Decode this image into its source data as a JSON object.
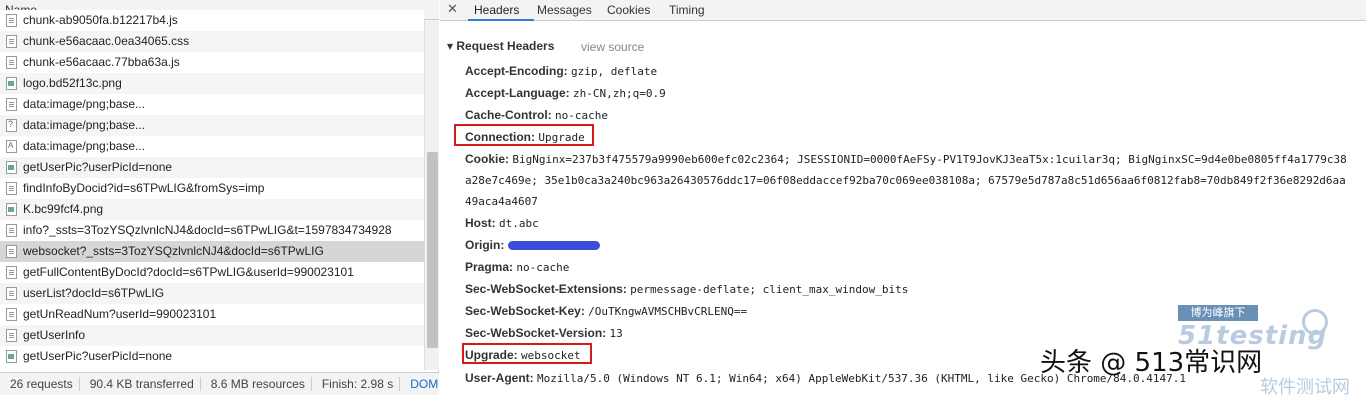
{
  "network": {
    "column_name": "Name",
    "rows": [
      {
        "name": "chunk-ab9050fa.b12217b4.js",
        "icon": "doc"
      },
      {
        "name": "chunk-e56acaac.0ea34065.css",
        "icon": "doc"
      },
      {
        "name": "chunk-e56acaac.77bba63a.js",
        "icon": "doc"
      },
      {
        "name": "logo.bd52f13c.png",
        "icon": "img"
      },
      {
        "name": "data:image/png;base...",
        "icon": "doc"
      },
      {
        "name": "data:image/png;base...",
        "icon": "q"
      },
      {
        "name": "data:image/png;base...",
        "icon": "a"
      },
      {
        "name": "getUserPic?userPicId=none",
        "icon": "img"
      },
      {
        "name": "findInfoByDocid?id=s6TPwLIG&fromSys=imp",
        "icon": "doc"
      },
      {
        "name": "K.bc99fcf4.png",
        "icon": "img"
      },
      {
        "name": "info?_ssts=3TozYSQzlvnlcNJ4&docId=s6TPwLIG&t=1597834734928",
        "icon": "doc"
      },
      {
        "name": "websocket?_ssts=3TozYSQzlvnlcNJ4&docId=s6TPwLIG",
        "icon": "doc"
      },
      {
        "name": "getFullContentByDocId?docId=s6TPwLIG&userId=990023101",
        "icon": "doc"
      },
      {
        "name": "userList?docId=s6TPwLIG",
        "icon": "doc"
      },
      {
        "name": "getUnReadNum?userId=990023101",
        "icon": "doc"
      },
      {
        "name": "getUserInfo",
        "icon": "doc"
      },
      {
        "name": "getUserPic?userPicId=none",
        "icon": "img"
      }
    ],
    "selected_index": 11,
    "status": {
      "requests": "26 requests",
      "transferred": "90.4 KB transferred",
      "resources": "8.6 MB resources",
      "finish": "Finish: 2.98 s",
      "domcontent": "DOMC"
    }
  },
  "details": {
    "close_glyph": "✕",
    "tabs": [
      "Headers",
      "Messages",
      "Cookies",
      "Timing"
    ],
    "active_tab": "Headers",
    "section_title": "▾ Request Headers",
    "view_source": "view source",
    "headers": [
      {
        "name": "Accept-Encoding:",
        "value": "gzip, deflate"
      },
      {
        "name": "Accept-Language:",
        "value": "zh-CN,zh;q=0.9"
      },
      {
        "name": "Cache-Control:",
        "value": "no-cache"
      },
      {
        "name": "Connection:",
        "value": "Upgrade",
        "highlighted": true
      },
      {
        "name": "Cookie:",
        "value": "BigNginx=237b3f475579a9990eb600efc02c2364; JSESSIONID=0000fAeFSy-PV1T9JovKJ3eaT5x:1cuilar3q; BigNginxSC=9d4e0be0805ff4a1779c38"
      },
      {
        "name": "Host:",
        "value": "dt.abc"
      },
      {
        "name": "Origin:",
        "value": ""
      },
      {
        "name": "Pragma:",
        "value": "no-cache"
      },
      {
        "name": "Sec-WebSocket-Extensions:",
        "value": "permessage-deflate; client_max_window_bits"
      },
      {
        "name": "Sec-WebSocket-Key:",
        "value": "/OuTKngwAVMSCHBvCRLENQ=="
      },
      {
        "name": "Sec-WebSocket-Version:",
        "value": "13"
      },
      {
        "name": "Upgrade:",
        "value": "websocket",
        "highlighted": true
      },
      {
        "name": "User-Agent:",
        "value": "Mozilla/5.0 (Windows NT 6.1; Win64; x64) AppleWebKit/537.36 (KHTML, like Gecko) Chrome/84.0.4147.1"
      }
    ],
    "cookie_continuation": [
      "a28e7c469e; 35e1b0ca3a240bc963a26430576ddc17=06f08eddaccef92ba70c069ee038108a; 67579e5d787a8c51d656aa6f0812fab8=70db849f2f36e8292d6aa",
      "49aca4a4607"
    ]
  },
  "watermark": {
    "badge": "博为峰旗下",
    "logo": "51testing",
    "text": "头条 @ 513常识网",
    "sub": "软件测试网"
  }
}
